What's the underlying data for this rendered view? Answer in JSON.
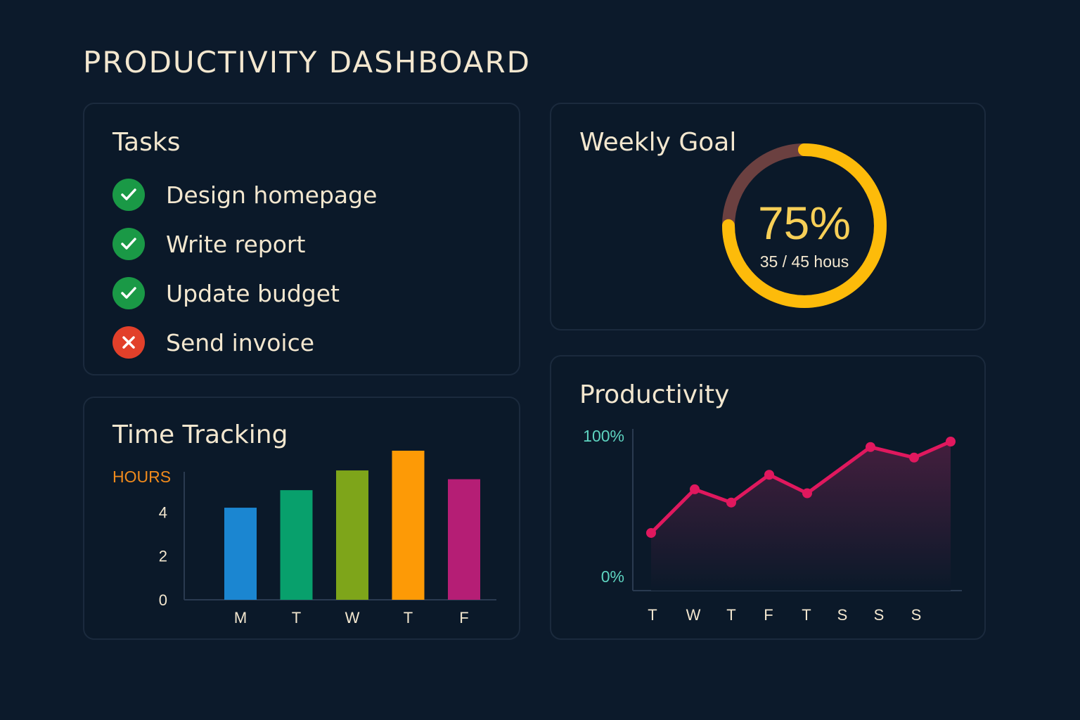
{
  "page": {
    "title": "PRODUCTIVITY DASHBOARD",
    "background": "#0c1a2b"
  },
  "tasks": {
    "title": "Tasks",
    "items": [
      {
        "label": "Design homepage",
        "status": "done",
        "icon": "check-icon"
      },
      {
        "label": "Write report",
        "status": "done",
        "icon": "check-icon"
      },
      {
        "label": "Update budget",
        "status": "done",
        "icon": "check-icon"
      },
      {
        "label": "Send invoice",
        "status": "failed",
        "icon": "x-icon"
      }
    ],
    "colors": {
      "done": "#1a9946",
      "failed": "#e2402a"
    }
  },
  "weekly_goal": {
    "title": "Weekly Goal",
    "percent_label": "75%",
    "hours_label": "35 / 45 hous",
    "progress": 0.75,
    "colors": {
      "fill": "#fdbb0a",
      "track": "#6b4040"
    }
  },
  "time_tracking": {
    "title": "Time Tracking",
    "unit_label": "HOURS",
    "colors": {
      "unit": "#f08a1c",
      "ticks": "#f3e7cf"
    },
    "chart_data": {
      "type": "bar",
      "categories": [
        "M",
        "T",
        "W",
        "T",
        "F"
      ],
      "values": [
        4.2,
        5.0,
        5.9,
        6.8,
        5.5
      ],
      "colors": [
        "#1b86d1",
        "#08a06c",
        "#7ea51a",
        "#fd9a06",
        "#b51e75"
      ],
      "ylim": [
        0,
        6.8
      ],
      "yticks": [
        "0",
        "2",
        "4"
      ],
      "ytick_values": [
        0,
        2,
        4
      ]
    }
  },
  "productivity": {
    "title": "Productivity",
    "colors": {
      "line": "#e0185e",
      "ticks": "#5ed4c0",
      "labels": "#f3e7cf"
    },
    "chart_data": {
      "type": "area",
      "categories": [
        "T",
        "W",
        "T",
        "F",
        "T",
        "S",
        "S",
        "S"
      ],
      "x_points": [
        0,
        1,
        2,
        3,
        4,
        5,
        6,
        7,
        8
      ],
      "values": [
        33,
        66,
        56,
        77,
        63,
        98,
        90,
        106,
        0
      ],
      "ylim": [
        0,
        100
      ],
      "ytick_labels": [
        "0%",
        "100%"
      ],
      "ytick_values": [
        0,
        100
      ]
    }
  }
}
